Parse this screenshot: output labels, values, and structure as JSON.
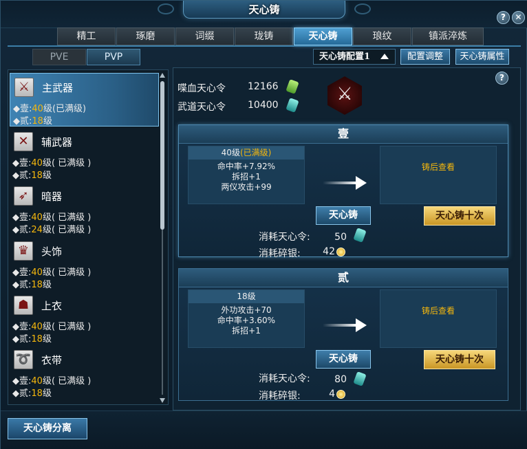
{
  "window": {
    "title": "天心铸",
    "help_icon": "question-icon",
    "close_icon": "close-icon"
  },
  "tabs": [
    {
      "label": "精工"
    },
    {
      "label": "琢磨"
    },
    {
      "label": "词缀"
    },
    {
      "label": "珑铸"
    },
    {
      "label": "天心铸",
      "active": true
    },
    {
      "label": "琅纹"
    },
    {
      "label": "镇派淬炼"
    }
  ],
  "modes": {
    "pve": "PVE",
    "pvp": "PVP",
    "selected": "PVP"
  },
  "config": {
    "selected": "天心铸配置1",
    "adjust_label": "配置调整",
    "attr_label": "天心铸属性"
  },
  "equipment": [
    {
      "name": "主武器",
      "line1_label": "◆壹:",
      "line1_level": "40",
      "line1_unit": "级",
      "line1_note": "(已满级)",
      "line2_label": "◆贰:",
      "line2_level": "18",
      "line2_unit": "级",
      "line2_note": "",
      "icon": "sword-icon",
      "glyph": "⚔"
    },
    {
      "name": "辅武器",
      "line1_label": "◆壹:",
      "line1_level": "40",
      "line1_unit": "级",
      "line1_note": "( 已满级 )",
      "line2_label": "◆贰:",
      "line2_level": "18",
      "line2_unit": "级",
      "line2_note": "",
      "icon": "offhand-weapon-icon",
      "glyph": "✕"
    },
    {
      "name": "暗器",
      "line1_label": "◆壹:",
      "line1_level": "40",
      "line1_unit": "级",
      "line1_note": "( 已满级 )",
      "line2_label": "◆贰:",
      "line2_level": "24",
      "line2_unit": "级",
      "line2_note": "( 已满级 )",
      "icon": "hidden-weapon-icon",
      "glyph": "➶"
    },
    {
      "name": "头饰",
      "line1_label": "◆壹:",
      "line1_level": "40",
      "line1_unit": "级",
      "line1_note": "( 已满级 )",
      "line2_label": "◆贰:",
      "line2_level": "18",
      "line2_unit": "级",
      "line2_note": "",
      "icon": "headwear-icon",
      "glyph": "♛"
    },
    {
      "name": "上衣",
      "line1_label": "◆壹:",
      "line1_level": "40",
      "line1_unit": "级",
      "line1_note": "( 已满级 )",
      "line2_label": "◆贰:",
      "line2_level": "18",
      "line2_unit": "级",
      "line2_note": "",
      "icon": "clothing-icon",
      "glyph": "☗"
    },
    {
      "name": "衣带",
      "line1_label": "◆壹:",
      "line1_level": "40",
      "line1_unit": "级",
      "line1_note": "( 已满级 )",
      "line2_label": "◆贰:",
      "line2_level": "18",
      "line2_unit": "级",
      "line2_note": "",
      "icon": "belt-icon",
      "glyph": "➰"
    }
  ],
  "resources": [
    {
      "label": "喋血天心令",
      "value": "12166",
      "icon": "green-token-icon"
    },
    {
      "label": "武道天心令",
      "value": "10400",
      "icon": "teal-token-icon"
    }
  ],
  "selected_equipment_icon": "sword-icon",
  "sections": [
    {
      "title": "壹",
      "current_level": "40级",
      "current_note": "(已满级)",
      "stats": [
        "命中率+7.92%",
        "拆招+1",
        "两仪攻击+99"
      ],
      "preview_text": "铸后查看",
      "cast_label": "天心铸",
      "cast10_label": "天心铸十次",
      "cost_token_label": "消耗天心令:",
      "cost_token_value": "50",
      "cost_silver_label": "消耗碎银:",
      "cost_silver_value": "42"
    },
    {
      "title": "贰",
      "current_level": "18级",
      "current_note": "",
      "stats": [
        "外功攻击+70",
        "命中率+3.60%",
        "拆招+1"
      ],
      "preview_text": "铸后查看",
      "cast_label": "天心铸",
      "cast10_label": "天心铸十次",
      "cost_token_label": "消耗天心令:",
      "cost_token_value": "80",
      "cost_silver_label": "消耗碎银:",
      "cost_silver_value": "4"
    }
  ],
  "footer": {
    "split_label": "天心铸分离"
  },
  "colors": {
    "accent": "#4f9fd2",
    "level_gold": "#f5b70d",
    "gold_button": "#e8c060"
  }
}
